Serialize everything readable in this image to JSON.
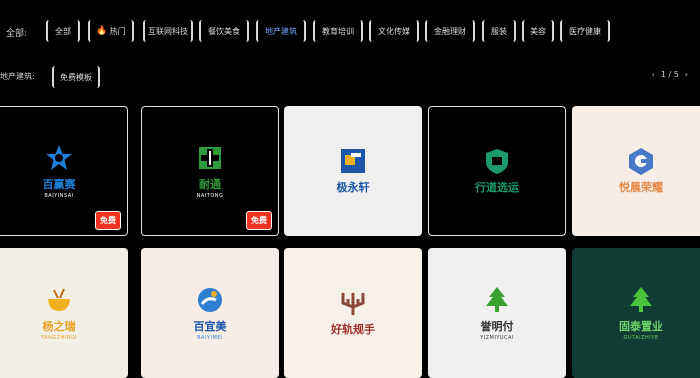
{
  "filters": {
    "label": "全部:",
    "chips": [
      {
        "label": "全部",
        "active": false
      },
      {
        "label": "热门",
        "active": false,
        "hot": true
      },
      {
        "label": "互联网科技",
        "active": false
      },
      {
        "label": "餐饮美食",
        "active": false
      },
      {
        "label": "地产建筑",
        "active": true
      },
      {
        "label": "教育培训",
        "active": false
      },
      {
        "label": "文化传媒",
        "active": false
      },
      {
        "label": "金融理财",
        "active": false
      },
      {
        "label": "服装",
        "active": false
      },
      {
        "label": "美容",
        "active": false
      },
      {
        "label": "医疗健康",
        "active": false
      }
    ]
  },
  "subfilter": {
    "label": "地产建筑:",
    "chip": "免费模板"
  },
  "pager": {
    "prev": "‹",
    "text": "1 / 5",
    "next": "›"
  },
  "cards": [
    {
      "name": "百赢赛",
      "sub": "BAIYINSAI",
      "bg": "#000000",
      "dark": true,
      "name_color": "#1e7fd6",
      "sub_color": "#ffffff",
      "icon": "star-logo-icon",
      "icon_color": "#1e7fd6",
      "badge": "免费"
    },
    {
      "name": "耐通",
      "sub": "NAITONG",
      "bg": "#000000",
      "dark": true,
      "name_color": "#2f9a3a",
      "sub_color": "#ffffff",
      "icon": "cross-logo-icon",
      "icon_color": "#2a9a3a",
      "badge": "免费"
    },
    {
      "name": "极永轩",
      "sub": "",
      "bg": "#f0f0f0",
      "dark": false,
      "name_color": "#1b56a8",
      "sub_color": "#1b56a8",
      "icon": "square-logo-icon",
      "icon_color": "#1b56a8"
    },
    {
      "name": "行道选运",
      "sub": "",
      "bg": "#000000",
      "dark": true,
      "name_color": "#1a9a6a",
      "sub_color": "#ffffff",
      "icon": "shield-logo-icon",
      "icon_color": "#1a9a6a"
    },
    {
      "name": "悦晨荣耀",
      "sub": "",
      "bg": "#f6ede6",
      "dark": false,
      "name_color": "#e58a4a",
      "sub_color": "#e58a4a",
      "icon": "hexagon-logo-icon",
      "icon_color": "#4a78c8"
    },
    {
      "name": "杨之瑞",
      "sub": "YANGZHIRUI",
      "bg": "#f2efe6",
      "dark": false,
      "name_color": "#e8a020",
      "sub_color": "#e8a020",
      "icon": "bowl-logo-icon",
      "icon_color": "#f0b020"
    },
    {
      "name": "百宜美",
      "sub": "BAIYIMEI",
      "bg": "#f6ede6",
      "dark": false,
      "name_color": "#1b56a8",
      "sub_color": "#3d84d6",
      "icon": "runner-logo-icon",
      "icon_color": "#2f7fd0"
    },
    {
      "name": "好轨规手",
      "sub": "",
      "bg": "#f7f1e9",
      "dark": false,
      "name_color": "#a0302a",
      "sub_color": "#a0302a",
      "icon": "trident-logo-icon",
      "icon_color": "#8a4a3a"
    },
    {
      "name": "誉明付",
      "sub": "YIZMIYUCAI",
      "bg": "#f0f0f0",
      "dark": false,
      "name_color": "#333333",
      "sub_color": "#333333",
      "icon": "tree-logo-icon",
      "icon_color": "#3aa030"
    },
    {
      "name": "固泰置业",
      "sub": "GUTAIZHIYE",
      "bg": "#0f3d34",
      "dark": false,
      "name_color": "#6fd06a",
      "sub_color": "#6fd06a",
      "icon": "tree-logo-icon",
      "icon_color": "#4ac43a"
    }
  ]
}
